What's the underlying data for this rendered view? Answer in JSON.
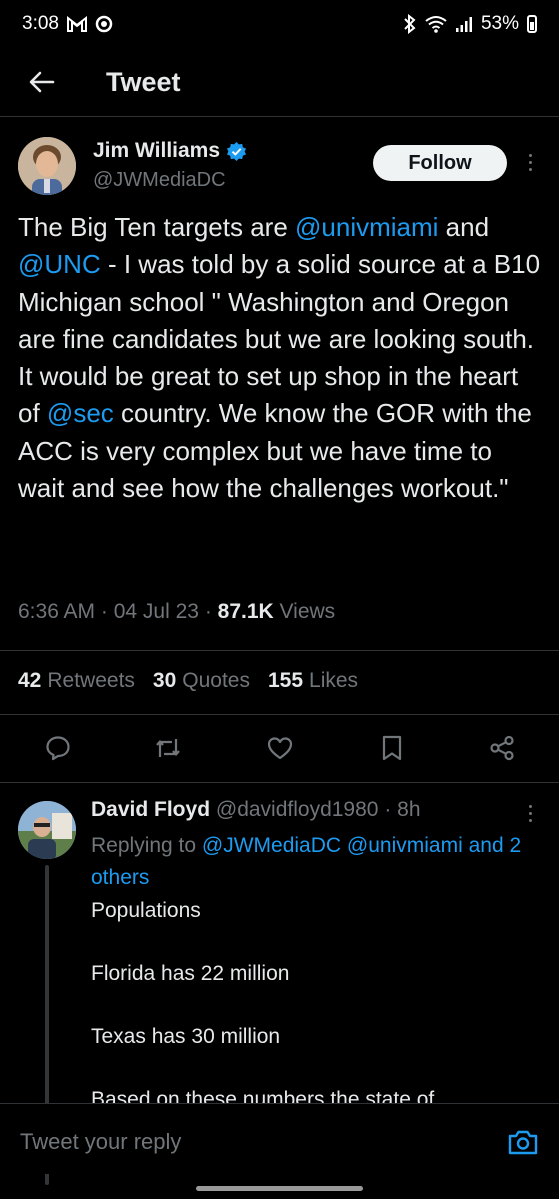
{
  "status_bar": {
    "time": "3:08",
    "battery": "53%"
  },
  "header": {
    "title": "Tweet"
  },
  "tweet": {
    "author_name": "Jim Williams",
    "author_handle": "@JWMediaDC",
    "follow_label": "Follow",
    "text": {
      "p1": "The Big Ten targets are ",
      "m1": "@univmiami",
      "p2": " and ",
      "m2": "@UNC",
      "p3": " - I was told by a solid source at a B10 Michigan school  \" Washington and Oregon are fine candidates but we are looking south.  It would be great to set up shop in the heart of ",
      "m3": "@sec",
      "p4": " country.  We know the GOR with the ACC is very complex but we have time to wait and see how the challenges workout.\""
    },
    "time": "6:36 AM",
    "date": "04 Jul 23",
    "views_count": "87.1K",
    "views_label": "Views",
    "retweets_count": "42",
    "retweets_label": "Retweets",
    "quotes_count": "30",
    "quotes_label": "Quotes",
    "likes_count": "155",
    "likes_label": "Likes"
  },
  "reply": {
    "author_name": "David Floyd",
    "author_handle": "@davidfloyd1980",
    "age": "8h",
    "replying_prefix": "Replying to ",
    "replying_to_1": "@JWMediaDC",
    "replying_to_2": "@univmiami",
    "replying_others": "and 2 others",
    "lines": [
      "Populations",
      "Florida has 22 million",
      "Texas has 30 million",
      "Based on these numbers the state of"
    ]
  },
  "composer": {
    "placeholder": "Tweet your reply"
  },
  "colors": {
    "accent": "#1d9bf0",
    "background": "#000000",
    "muted": "#71767b"
  },
  "icons": {
    "back": "arrow-left-icon",
    "verified": "verified-badge-icon",
    "reply": "comment-icon",
    "retweet": "retweet-icon",
    "like": "heart-icon",
    "bookmark": "bookmark-icon",
    "share": "share-icon",
    "camera": "camera-icon"
  }
}
